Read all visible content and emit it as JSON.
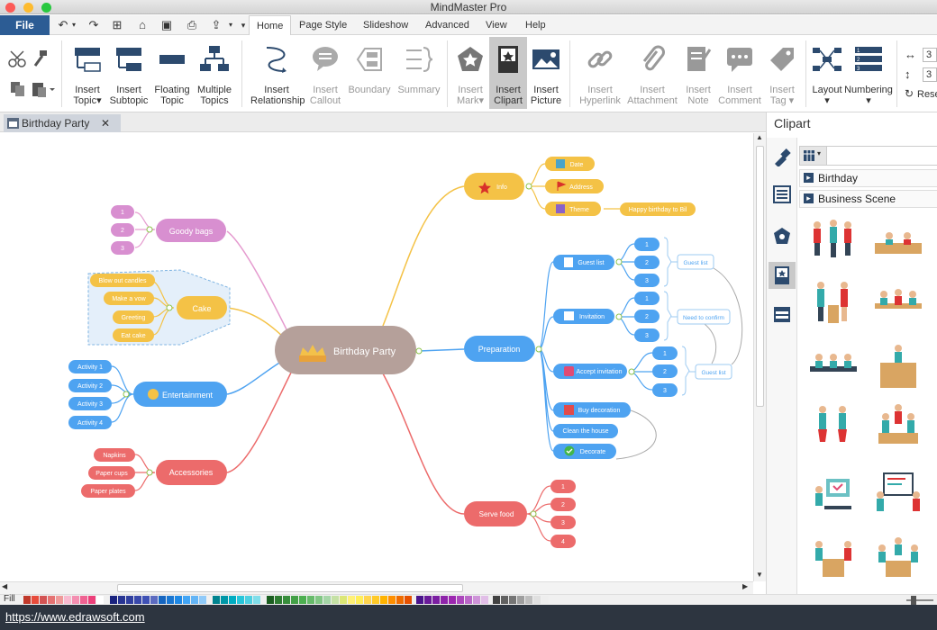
{
  "window": {
    "title": "MindMaster Pro"
  },
  "menu": {
    "file": "File",
    "tabs": [
      "Home",
      "Page Style",
      "Slideshow",
      "Advanced",
      "View",
      "Help"
    ]
  },
  "ribbon": {
    "insert_topic": [
      "Insert",
      "Topic"
    ],
    "insert_subtopic": [
      "Insert",
      "Subtopic"
    ],
    "floating_topic": [
      "Floating",
      "Topic"
    ],
    "multiple_topics": [
      "Multiple",
      "Topics"
    ],
    "insert_relationship": [
      "Insert",
      "Relationship"
    ],
    "insert_callout": [
      "Insert",
      "Callout"
    ],
    "boundary": [
      "Boundary",
      ""
    ],
    "summary": [
      "Summary",
      ""
    ],
    "insert_mark": [
      "Insert",
      "Mark"
    ],
    "insert_clipart": [
      "Insert",
      "Clipart"
    ],
    "insert_picture": [
      "Insert",
      "Picture"
    ],
    "insert_hyperlink": [
      "Insert",
      "Hyperlink"
    ],
    "insert_attachment": [
      "Insert",
      "Attachment"
    ],
    "insert_note": [
      "Insert",
      "Note"
    ],
    "insert_comment": [
      "Insert",
      "Comment"
    ],
    "insert_tag": [
      "Insert",
      "Tag"
    ],
    "layout": "Layout",
    "numbering": "Numbering",
    "spin_value_1": "3",
    "spin_value_2": "3",
    "reset": "Rese"
  },
  "document": {
    "tab_title": "Birthday Party"
  },
  "mindmap": {
    "central": "Birthday Party",
    "branches": {
      "goody_bags": {
        "label": "Goody bags",
        "children": [
          "1",
          "2",
          "3"
        ]
      },
      "cake": {
        "label": "Cake",
        "children": [
          "Blow out candles",
          "Make a vow",
          "Greeting",
          "Eat cake"
        ]
      },
      "entertainment": {
        "label": "Entertainment",
        "children": [
          "Activity 1",
          "Activity 2",
          "Activity 3",
          "Activity 4"
        ]
      },
      "accessories": {
        "label": "Accessories",
        "children": [
          "Napkins",
          "Paper cups",
          "Paper plates"
        ]
      },
      "info": {
        "label": "Info",
        "children": [
          "Date",
          "Address",
          "Theme"
        ],
        "theme_note": "Happy birthday to Bil"
      },
      "preparation": {
        "label": "Preparation",
        "guest_list": {
          "label": "Guest list",
          "children": [
            "1",
            "2",
            "3"
          ],
          "callout": "Guest list"
        },
        "invitation": {
          "label": "Invitation",
          "children": [
            "1",
            "2",
            "3"
          ],
          "callout": "Need to confirm"
        },
        "accept_invitation": {
          "label": "Accept invitation",
          "children": [
            "1",
            "2",
            "3"
          ],
          "callout": "Guest list"
        },
        "buy_decoration": "Buy decoration",
        "clean_house": "Clean the house",
        "decorate": "Decorate"
      },
      "serve_food": {
        "label": "Serve food",
        "children": [
          "1",
          "2",
          "3",
          "4"
        ]
      }
    }
  },
  "panel": {
    "title": "Clipart",
    "categories": [
      "Birthday",
      "Business Scene"
    ]
  },
  "colorbar": {
    "label": "Fill"
  },
  "status": {
    "url": "https://www.edrawsoft.com"
  }
}
